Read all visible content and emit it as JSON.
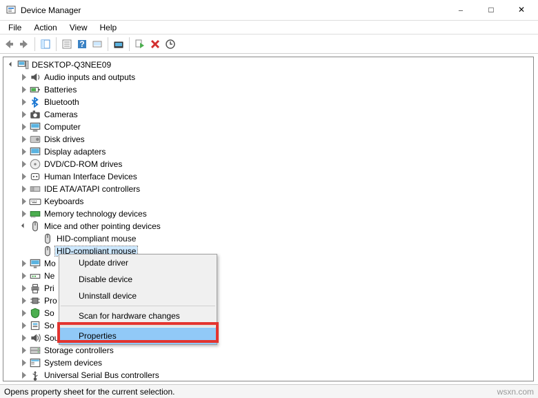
{
  "title": "Device Manager",
  "status": "Opens property sheet for the current selection.",
  "watermark": "wsxn.com",
  "menu": [
    "File",
    "Action",
    "View",
    "Help"
  ],
  "root": "DESKTOP-Q3NEE09",
  "categories": [
    {
      "label": "Audio inputs and outputs",
      "icon": "audio"
    },
    {
      "label": "Batteries",
      "icon": "battery"
    },
    {
      "label": "Bluetooth",
      "icon": "bluetooth"
    },
    {
      "label": "Cameras",
      "icon": "camera"
    },
    {
      "label": "Computer",
      "icon": "computer"
    },
    {
      "label": "Disk drives",
      "icon": "disk"
    },
    {
      "label": "Display adapters",
      "icon": "display"
    },
    {
      "label": "DVD/CD-ROM drives",
      "icon": "dvd"
    },
    {
      "label": "Human Interface Devices",
      "icon": "hid"
    },
    {
      "label": "IDE ATA/ATAPI controllers",
      "icon": "ide"
    },
    {
      "label": "Keyboards",
      "icon": "keyboard"
    },
    {
      "label": "Memory technology devices",
      "icon": "memory"
    }
  ],
  "mice": {
    "label": "Mice and other pointing devices",
    "children": [
      {
        "label": "HID-compliant mouse"
      },
      {
        "label": "HID-compliant mouse"
      }
    ]
  },
  "after": [
    {
      "label": "Mo",
      "icon": "monitor"
    },
    {
      "label": "Ne",
      "icon": "network"
    },
    {
      "label": "Pri",
      "icon": "print"
    },
    {
      "label": "Pro",
      "icon": "processor"
    },
    {
      "label": "So",
      "icon": "security"
    },
    {
      "label": "So",
      "icon": "software"
    },
    {
      "label": "Sou",
      "icon": "sound"
    },
    {
      "label": "Storage controllers",
      "icon": "storage"
    },
    {
      "label": "System devices",
      "icon": "system"
    },
    {
      "label": "Universal Serial Bus controllers",
      "icon": "usb"
    }
  ],
  "context": [
    {
      "label": "Update driver"
    },
    {
      "label": "Disable device"
    },
    {
      "label": "Uninstall device"
    },
    {
      "sep": true
    },
    {
      "label": "Scan for hardware changes"
    },
    {
      "sep": true
    },
    {
      "label": "Properties",
      "hl": true
    }
  ]
}
